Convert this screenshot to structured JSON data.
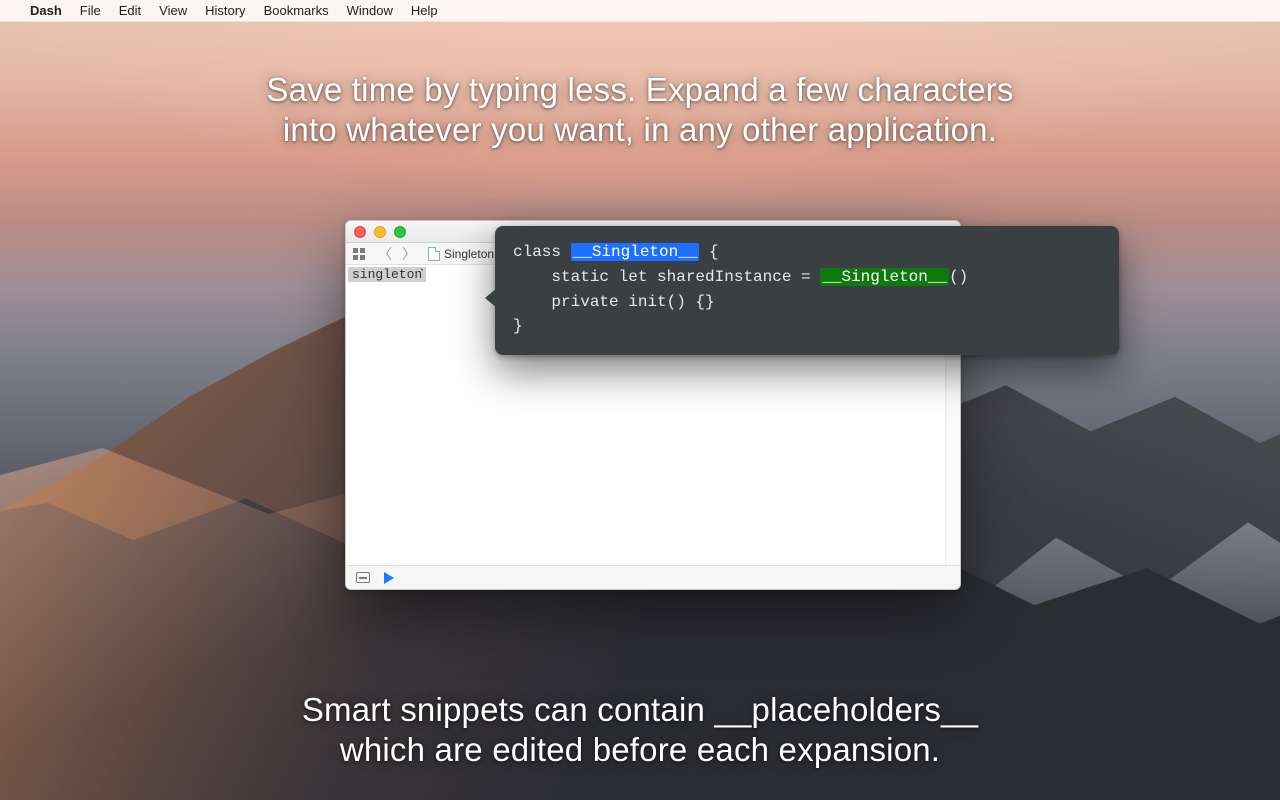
{
  "menubar": {
    "apple": "",
    "app": "Dash",
    "items": [
      "File",
      "Edit",
      "View",
      "History",
      "Bookmarks",
      "Window",
      "Help"
    ]
  },
  "hero": {
    "top_line1": "Save time by typing less. Expand a few characters",
    "top_line2": "into whatever you want, in any other application.",
    "bottom_line1": "Smart snippets can contain __placeholders__",
    "bottom_line2": "which are edited before each expansion."
  },
  "window": {
    "breadcrumb_file": "Singleton",
    "typed_text": "singleton",
    "tick": "`"
  },
  "snippet": {
    "l1a": "class ",
    "l1_ph": "__Singleton__",
    "l1b": " {",
    "l2a": "    static let sharedInstance = ",
    "l2_ph": "__Singleton__",
    "l2b": "()",
    "l3": "    private init() {}",
    "l4": "}"
  }
}
